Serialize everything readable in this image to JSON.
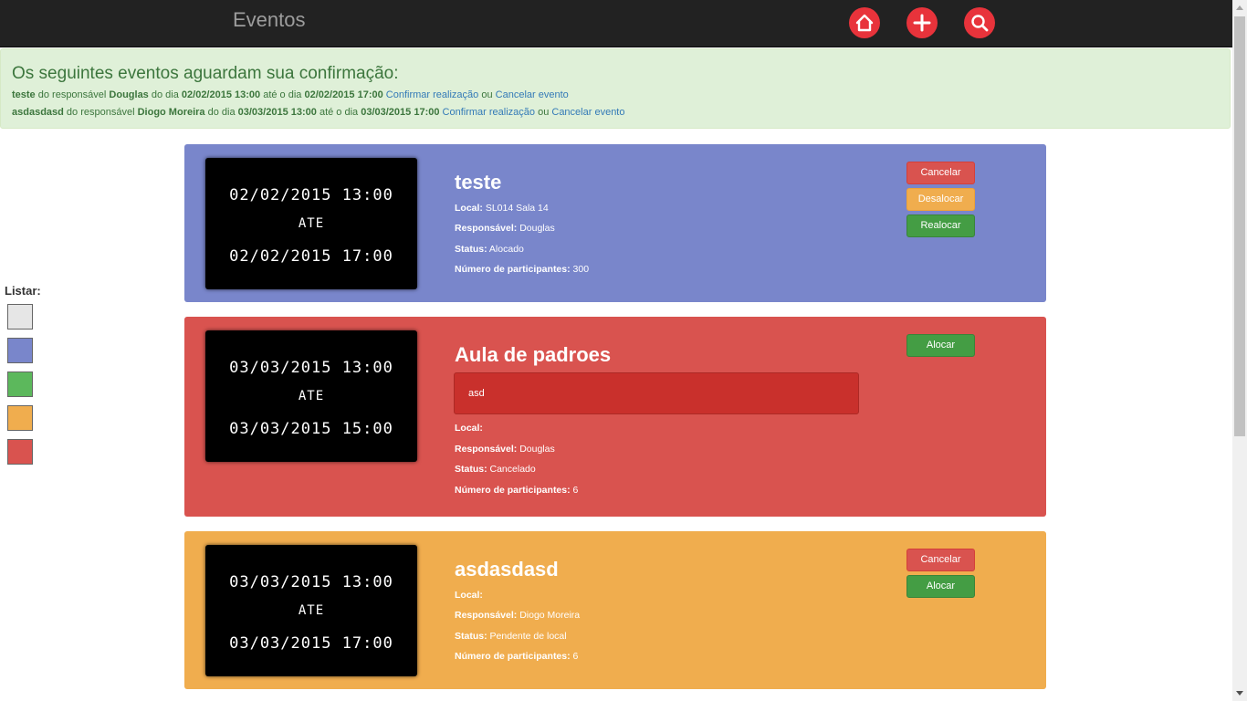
{
  "navbar": {
    "brand": "Eventos",
    "colors": {
      "background": "#222222",
      "button": "#e8333b"
    },
    "buttons": [
      {
        "name": "home",
        "icon": "home-icon"
      },
      {
        "name": "add",
        "icon": "plus-icon"
      },
      {
        "name": "search",
        "icon": "search-icon"
      }
    ]
  },
  "alert": {
    "title": "Os seguintes eventos aguardam sua confirmação:",
    "items": [
      {
        "event": "teste",
        "text1": " do responsável ",
        "responsible": "Douglas",
        "text2": " do dia ",
        "start": "02/02/2015 13:00",
        "text3": " até o dia ",
        "end": "02/02/2015 17:00",
        "confirm": "Confirmar realização",
        "or": " ou ",
        "cancel": "Cancelar evento"
      },
      {
        "event": "asdasdasd",
        "text1": " do responsável ",
        "responsible": "Diogo Moreira",
        "text2": " do dia ",
        "start": "03/03/2015 13:00",
        "text3": " até o dia ",
        "end": "03/03/2015 17:00",
        "confirm": "Confirmar realização",
        "or": " ou ",
        "cancel": "Cancelar evento"
      }
    ]
  },
  "legend": {
    "label": "Listar:",
    "swatches": [
      "#e6e6e6",
      "#7986cb",
      "#5cb85c",
      "#f0ad4e",
      "#d9534f"
    ]
  },
  "labels": {
    "local": "Local:",
    "responsible": "Responsável:",
    "status": "Status:",
    "participants": "Número de participantes:"
  },
  "events": [
    {
      "color": "blue",
      "start": "02/02/2015 13:00",
      "separator": "ATE",
      "end": "02/02/2015 17:00",
      "title": "teste",
      "local": " SL014 Sala 14",
      "responsible": " Douglas",
      "status": " Alocado",
      "participants": " 300",
      "buttons": [
        "Cancelar",
        "Desalocar",
        "Realocar"
      ]
    },
    {
      "color": "red",
      "start": "03/03/2015 13:00",
      "separator": "ATE",
      "end": "03/03/2015 15:00",
      "title": "Aula de padroes",
      "reason": "asd",
      "local": "",
      "responsible": " Douglas",
      "status": " Cancelado",
      "participants": " 6",
      "buttons": [
        "Alocar"
      ]
    },
    {
      "color": "orange",
      "start": "03/03/2015 13:00",
      "separator": "ATE",
      "end": "03/03/2015 17:00",
      "title": "asdasdasd",
      "local": "",
      "responsible": " Diogo Moreira",
      "status": " Pendente de local",
      "participants": " 6",
      "buttons": [
        "Cancelar",
        "Alocar"
      ]
    }
  ]
}
